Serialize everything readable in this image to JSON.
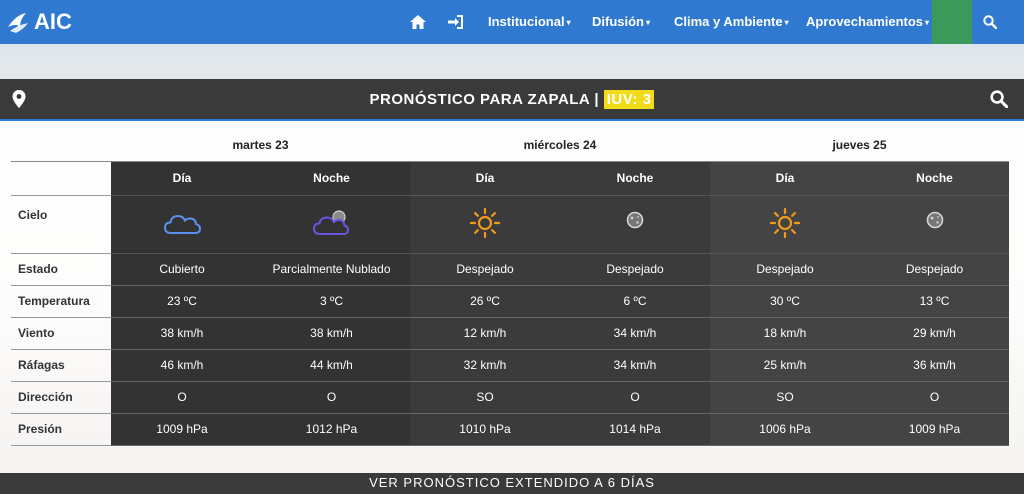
{
  "brand": {
    "logo_text": "AIC"
  },
  "nav": {
    "items": [
      {
        "label": "Institucional"
      },
      {
        "label": "Difusión"
      },
      {
        "label": "Clima y Ambiente"
      },
      {
        "label": "Aprovechamientos"
      }
    ],
    "caret": "▾"
  },
  "colors": {
    "nav_bg": "#2f7ad0",
    "nav_accent": "#3b9a5a",
    "uv_badge": "#f2dc1a",
    "panel_dark": "#333333"
  },
  "forecast": {
    "title": "PRONÓSTICO PARA ZAPALA |",
    "uv_label": "IUV: 3",
    "days": [
      "martes 23",
      "miércoles 24",
      "jueves 25"
    ],
    "period_labels": [
      "Día",
      "Noche",
      "Día",
      "Noche",
      "Día",
      "Noche"
    ],
    "row_labels": {
      "cielo": "Cielo",
      "estado": "Estado",
      "temperatura": "Temperatura",
      "viento": "Viento",
      "rafagas": "Ráfagas",
      "direccion": "Dirección",
      "presion": "Presión"
    },
    "icons": [
      "cloudy-icon",
      "partly-cloudy-night-icon",
      "sun-icon",
      "clear-night-icon",
      "sun-icon",
      "clear-night-icon"
    ],
    "estado": [
      "Cubierto",
      "Parcialmente Nublado",
      "Despejado",
      "Despejado",
      "Despejado",
      "Despejado"
    ],
    "temperatura": [
      "23 ºC",
      "3 ºC",
      "26 ºC",
      "6 ºC",
      "30 ºC",
      "13 ºC"
    ],
    "viento": [
      "38 km/h",
      "38 km/h",
      "12 km/h",
      "34 km/h",
      "18 km/h",
      "29 km/h"
    ],
    "rafagas": [
      "46 km/h",
      "44 km/h",
      "32 km/h",
      "34 km/h",
      "25 km/h",
      "36 km/h"
    ],
    "direccion": [
      "O",
      "O",
      "SO",
      "O",
      "SO",
      "O"
    ],
    "presion": [
      "1009 hPa",
      "1012 hPa",
      "1010 hPa",
      "1014 hPa",
      "1006 hPa",
      "1009 hPa"
    ],
    "extended_link": "VER PRONÓSTICO EXTENDIDO A 6 DÍAS"
  }
}
